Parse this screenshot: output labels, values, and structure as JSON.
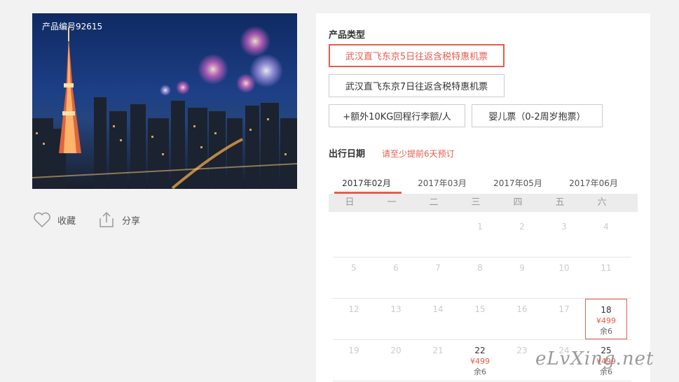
{
  "hero": {
    "product_code": "产品编号92615"
  },
  "actions": {
    "favorite": "收藏",
    "share": "分享"
  },
  "product_type": {
    "title": "产品类型",
    "options": [
      "武汉直飞东京5日往返含税特惠机票",
      "武汉直飞东京7日往返含税特惠机票",
      "+额外10KG回程行李额/人",
      "婴儿票（0-2周岁抱票）"
    ],
    "selected_index": 0
  },
  "departure": {
    "title": "出行日期",
    "notice": "请至少提前6天预订",
    "months": [
      "2017年02月",
      "2017年03月",
      "2017年05月",
      "2017年06月"
    ],
    "active_month": 0,
    "weekdays": [
      "日",
      "一",
      "二",
      "三",
      "四",
      "五",
      "六"
    ],
    "weeks": [
      [
        {
          "d": ""
        },
        {
          "d": ""
        },
        {
          "d": ""
        },
        {
          "d": "1"
        },
        {
          "d": "2"
        },
        {
          "d": "3"
        },
        {
          "d": "4"
        }
      ],
      [
        {
          "d": "5"
        },
        {
          "d": "6"
        },
        {
          "d": "7"
        },
        {
          "d": "8"
        },
        {
          "d": "9"
        },
        {
          "d": "10"
        },
        {
          "d": "11"
        }
      ],
      [
        {
          "d": "12"
        },
        {
          "d": "13"
        },
        {
          "d": "14"
        },
        {
          "d": "15"
        },
        {
          "d": "16"
        },
        {
          "d": "17"
        },
        {
          "d": "18",
          "price": "¥499",
          "stock": "余6",
          "selected": true
        }
      ],
      [
        {
          "d": "19"
        },
        {
          "d": "20"
        },
        {
          "d": "21"
        },
        {
          "d": "22",
          "price": "¥499",
          "stock": "余6"
        },
        {
          "d": "23"
        },
        {
          "d": "24"
        },
        {
          "d": "25",
          "price": "¥499",
          "stock": "余6"
        }
      ]
    ]
  },
  "watermark": "eLvXing.net",
  "colors": {
    "accent": "#e65c4f",
    "panel_bg": "#ffffff",
    "page_bg": "#f2f2f2"
  }
}
